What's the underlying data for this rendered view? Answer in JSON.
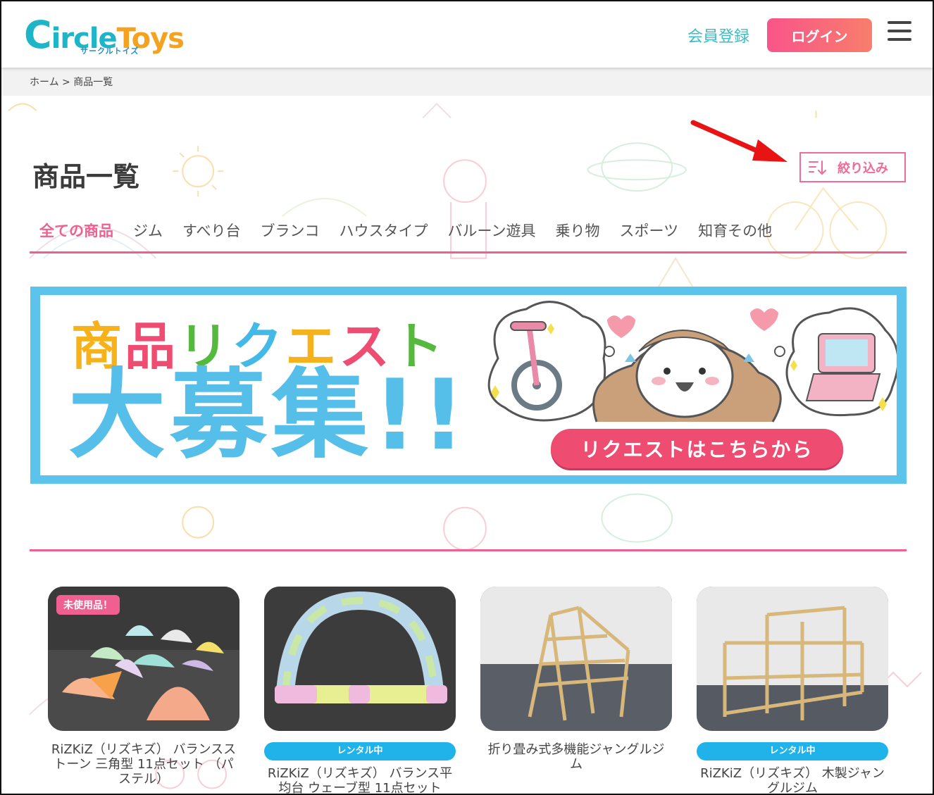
{
  "header": {
    "logo_text_main": "ircle",
    "logo_text_c": "C",
    "logo_text_toys": "Toys",
    "logo_sub": "サークルトイズ",
    "member_register": "会員登録",
    "login": "ログイン"
  },
  "breadcrumb": "ホーム > 商品一覧",
  "page_title": "商品一覧",
  "filter_label": "絞り込み",
  "categories": [
    {
      "label": "全ての商品",
      "active": true
    },
    {
      "label": "ジム"
    },
    {
      "label": "すべり台"
    },
    {
      "label": "ブランコ"
    },
    {
      "label": "ハウスタイプ"
    },
    {
      "label": "バルーン遊具"
    },
    {
      "label": "乗り物"
    },
    {
      "label": "スポーツ"
    },
    {
      "label": "知育その他"
    }
  ],
  "banner": {
    "line1": [
      "商",
      "品",
      "リ",
      "ク",
      "エ",
      "ス",
      "ト"
    ],
    "line2": "大募集!!",
    "cta": "リクエストはこちらから"
  },
  "products": [
    {
      "name": "RiZKiZ（リズキズ） バランスストーン 三角型 11点セット （パステル）",
      "badge": "未使用品！",
      "status": ""
    },
    {
      "name": "RiZKiZ（リズキズ） バランス平均台 ウェーブ型 11点セット",
      "badge": "",
      "status": "レンタル中"
    },
    {
      "name": "折り畳み式多機能ジャングルジム",
      "badge": "",
      "status": ""
    },
    {
      "name": "RiZKiZ（リズキズ） 木製ジャングルジム",
      "badge": "",
      "status": "レンタル中"
    }
  ],
  "colors": {
    "accent_pink": "#ef5f8f",
    "teal": "#3cbcc4",
    "banner_blue": "#5bc3ec",
    "rental_blue": "#1fb3ea"
  }
}
